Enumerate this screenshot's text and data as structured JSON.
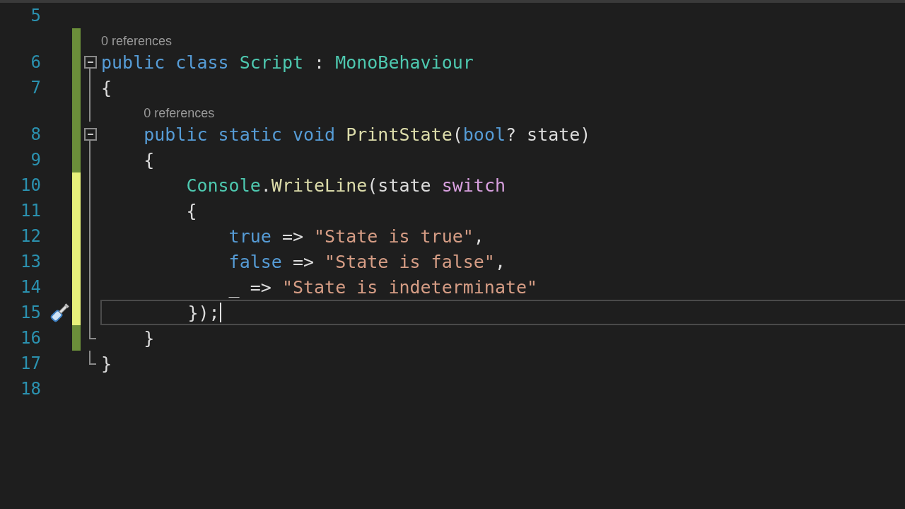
{
  "editor": {
    "lines": [
      {
        "number": "5",
        "current": false,
        "quick_actions": false
      },
      {
        "number": "6",
        "change": {
          "kind": "saved"
        },
        "fold": {
          "kind": "toggle",
          "expanded": true
        },
        "current": false,
        "quick_actions": false,
        "codelens": "0 references",
        "tokens": [
          {
            "kind": "keyword",
            "text": "public "
          },
          {
            "kind": "keyword",
            "text": "class "
          },
          {
            "kind": "type",
            "text": "Script "
          },
          {
            "kind": "plain",
            "text": ": "
          },
          {
            "kind": "type",
            "text": "MonoBehaviour"
          }
        ]
      },
      {
        "number": "7",
        "change": {
          "kind": "saved"
        },
        "fold": {
          "kind": "guide"
        },
        "current": false,
        "quick_actions": false,
        "tokens": [
          {
            "kind": "plain",
            "text": "{"
          }
        ]
      },
      {
        "number": "8",
        "change": {
          "kind": "saved"
        },
        "fold": {
          "kind": "toggle",
          "expanded": true
        },
        "current": false,
        "quick_actions": false,
        "codelens": "0 references",
        "tokens": [
          {
            "kind": "keyword",
            "text": "    public "
          },
          {
            "kind": "keyword",
            "text": "static "
          },
          {
            "kind": "keyword",
            "text": "void "
          },
          {
            "kind": "method",
            "text": "PrintState"
          },
          {
            "kind": "plain",
            "text": "("
          },
          {
            "kind": "keyword",
            "text": "bool"
          },
          {
            "kind": "plain",
            "text": "? state)"
          }
        ]
      },
      {
        "number": "9",
        "change": {
          "kind": "saved"
        },
        "fold": {
          "kind": "guide"
        },
        "current": false,
        "quick_actions": false,
        "tokens": [
          {
            "kind": "plain",
            "text": "    {"
          }
        ]
      },
      {
        "number": "10",
        "change": {
          "kind": "unsaved"
        },
        "fold": {
          "kind": "guide"
        },
        "current": false,
        "quick_actions": false,
        "tokens": [
          {
            "kind": "type",
            "text": "        Console"
          },
          {
            "kind": "plain",
            "text": "."
          },
          {
            "kind": "method",
            "text": "WriteLine"
          },
          {
            "kind": "plain",
            "text": "(state "
          },
          {
            "kind": "control",
            "text": "switch"
          }
        ]
      },
      {
        "number": "11",
        "change": {
          "kind": "unsaved"
        },
        "fold": {
          "kind": "guide"
        },
        "current": false,
        "quick_actions": false,
        "tokens": [
          {
            "kind": "plain",
            "text": "        {"
          }
        ]
      },
      {
        "number": "12",
        "change": {
          "kind": "unsaved"
        },
        "fold": {
          "kind": "guide"
        },
        "current": false,
        "quick_actions": false,
        "tokens": [
          {
            "kind": "keyword",
            "text": "            true"
          },
          {
            "kind": "plain",
            "text": " => "
          },
          {
            "kind": "string",
            "text": "\"State is true\""
          },
          {
            "kind": "plain",
            "text": ","
          }
        ]
      },
      {
        "number": "13",
        "change": {
          "kind": "unsaved"
        },
        "fold": {
          "kind": "guide"
        },
        "current": false,
        "quick_actions": false,
        "tokens": [
          {
            "kind": "keyword",
            "text": "            false"
          },
          {
            "kind": "plain",
            "text": " => "
          },
          {
            "kind": "string",
            "text": "\"State is false\""
          },
          {
            "kind": "plain",
            "text": ","
          }
        ]
      },
      {
        "number": "14",
        "change": {
          "kind": "unsaved"
        },
        "fold": {
          "kind": "guide"
        },
        "current": false,
        "quick_actions": false,
        "tokens": [
          {
            "kind": "plain",
            "text": "            _ => "
          },
          {
            "kind": "string",
            "text": "\"State is indeterminate\""
          }
        ]
      },
      {
        "number": "15",
        "change": {
          "kind": "unsaved"
        },
        "fold": {
          "kind": "guide"
        },
        "current": true,
        "quick_actions": true,
        "tokens": [
          {
            "kind": "plain",
            "text": "        });"
          }
        ]
      },
      {
        "number": "16",
        "change": {
          "kind": "saved"
        },
        "fold": {
          "kind": "end"
        },
        "current": false,
        "quick_actions": false,
        "tokens": [
          {
            "kind": "plain",
            "text": "    }"
          }
        ]
      },
      {
        "number": "17",
        "fold": {
          "kind": "end"
        },
        "current": false,
        "quick_actions": false,
        "tokens": [
          {
            "kind": "plain",
            "text": "}"
          }
        ]
      },
      {
        "number": "18",
        "current": false,
        "quick_actions": false
      }
    ]
  }
}
